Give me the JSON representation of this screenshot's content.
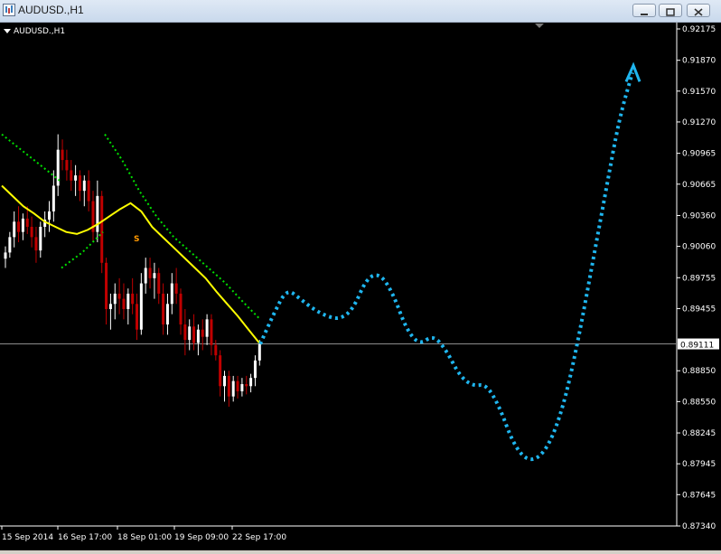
{
  "window": {
    "title": "AUDUSD.,H1"
  },
  "chart_label": "AUDUSD.,H1",
  "price_axis": [
    "0.92175",
    "0.91870",
    "0.91570",
    "0.91270",
    "0.90965",
    "0.90665",
    "0.90360",
    "0.90060",
    "0.89755",
    "0.89455",
    "0.89111",
    "0.88850",
    "0.88550",
    "0.88245",
    "0.87945",
    "0.87645",
    "0.87340"
  ],
  "current_price": "0.89111",
  "time_axis": [
    "15 Sep 2014",
    "16 Sep 17:00",
    "18 Sep 01:00",
    "19 Sep 09:00",
    "22 Sep 17:00"
  ],
  "annotation": "S",
  "colors": {
    "background": "#000000",
    "bull": "#ffffff",
    "bear": "#c00000",
    "ma": "#ffff00",
    "band": "#00e000",
    "forecast": "#1fb6ef",
    "axis": "#ffffff"
  },
  "chart_data": {
    "type": "candlestick",
    "ylim": [
      0.8734,
      0.92175
    ],
    "series": [
      {
        "name": "price_candles",
        "ohlc": [
          [
            0.8994,
            0.9006,
            0.8985,
            0.9
          ],
          [
            0.9,
            0.902,
            0.8995,
            0.9015
          ],
          [
            0.9015,
            0.904,
            0.9005,
            0.903
          ],
          [
            0.903,
            0.9045,
            0.901,
            0.902
          ],
          [
            0.902,
            0.9038,
            0.9012,
            0.9033
          ],
          [
            0.9033,
            0.9045,
            0.9018,
            0.9025
          ],
          [
            0.9025,
            0.9035,
            0.9005,
            0.9015
          ],
          [
            0.9015,
            0.9025,
            0.899,
            0.9002
          ],
          [
            0.9002,
            0.903,
            0.8995,
            0.9025
          ],
          [
            0.9025,
            0.904,
            0.9015,
            0.9032
          ],
          [
            0.9032,
            0.905,
            0.902,
            0.904
          ],
          [
            0.904,
            0.908,
            0.903,
            0.9065
          ],
          [
            0.9065,
            0.9115,
            0.9055,
            0.91
          ],
          [
            0.91,
            0.911,
            0.908,
            0.909
          ],
          [
            0.909,
            0.91,
            0.907,
            0.908
          ],
          [
            0.908,
            0.909,
            0.906,
            0.907
          ],
          [
            0.907,
            0.9085,
            0.9055,
            0.9075
          ],
          [
            0.9075,
            0.908,
            0.905,
            0.906
          ],
          [
            0.906,
            0.9075,
            0.9045,
            0.907
          ],
          [
            0.907,
            0.908,
            0.904,
            0.905
          ],
          [
            0.905,
            0.906,
            0.901,
            0.902
          ],
          [
            0.902,
            0.907,
            0.901,
            0.9055
          ],
          [
            0.9055,
            0.906,
            0.898,
            0.899
          ],
          [
            0.899,
            0.8995,
            0.893,
            0.8945
          ],
          [
            0.8945,
            0.896,
            0.8925,
            0.895
          ],
          [
            0.895,
            0.897,
            0.8935,
            0.896
          ],
          [
            0.896,
            0.8975,
            0.894,
            0.8955
          ],
          [
            0.8955,
            0.897,
            0.8935,
            0.8945
          ],
          [
            0.8945,
            0.8965,
            0.893,
            0.896
          ],
          [
            0.896,
            0.8975,
            0.894,
            0.895
          ],
          [
            0.895,
            0.896,
            0.8915,
            0.8925
          ],
          [
            0.8925,
            0.898,
            0.892,
            0.897
          ],
          [
            0.897,
            0.8995,
            0.896,
            0.8985
          ],
          [
            0.8985,
            0.8995,
            0.8965,
            0.8975
          ],
          [
            0.8975,
            0.899,
            0.8955,
            0.898
          ],
          [
            0.898,
            0.8985,
            0.895,
            0.896
          ],
          [
            0.896,
            0.897,
            0.892,
            0.893
          ],
          [
            0.893,
            0.896,
            0.892,
            0.895
          ],
          [
            0.895,
            0.898,
            0.894,
            0.897
          ],
          [
            0.897,
            0.8985,
            0.895,
            0.896
          ],
          [
            0.896,
            0.8965,
            0.892,
            0.893
          ],
          [
            0.893,
            0.8945,
            0.89,
            0.8915
          ],
          [
            0.8915,
            0.8935,
            0.8905,
            0.8928
          ],
          [
            0.8928,
            0.894,
            0.8905,
            0.8912
          ],
          [
            0.8912,
            0.893,
            0.89,
            0.8925
          ],
          [
            0.8925,
            0.8935,
            0.8905,
            0.8918
          ],
          [
            0.8918,
            0.894,
            0.891,
            0.8935
          ],
          [
            0.8935,
            0.894,
            0.89,
            0.891
          ],
          [
            0.891,
            0.8915,
            0.8895,
            0.89
          ],
          [
            0.89,
            0.8905,
            0.886,
            0.887
          ],
          [
            0.887,
            0.8885,
            0.8855,
            0.888
          ],
          [
            0.888,
            0.8885,
            0.885,
            0.886
          ],
          [
            0.886,
            0.888,
            0.8855,
            0.8875
          ],
          [
            0.8875,
            0.888,
            0.8858,
            0.8865
          ],
          [
            0.8865,
            0.8878,
            0.886,
            0.8872
          ],
          [
            0.8872,
            0.888,
            0.8862,
            0.887
          ],
          [
            0.887,
            0.8882,
            0.8864,
            0.8878
          ],
          [
            0.8878,
            0.89,
            0.887,
            0.8895
          ],
          [
            0.8895,
            0.8915,
            0.889,
            0.8911
          ]
        ]
      },
      {
        "name": "moving_average",
        "values": [
          0.9065,
          0.9055,
          0.9045,
          0.9038,
          0.903,
          0.9025,
          0.902,
          0.9018,
          0.9022,
          0.9028,
          0.9035,
          0.9042,
          0.9048,
          0.904,
          0.9025,
          0.9015,
          0.9005,
          0.8995,
          0.8985,
          0.8975,
          0.8962,
          0.895,
          0.8938,
          0.8925,
          0.8912
        ]
      },
      {
        "name": "band_upper",
        "values": [
          0.9115,
          0.91,
          0.9085,
          0.907
        ]
      },
      {
        "name": "band_lower",
        "values": [
          0.8985,
          0.9,
          0.902
        ]
      },
      {
        "name": "band_upper_2",
        "values": [
          0.9115,
          0.909,
          0.906,
          0.9035,
          0.9015,
          0.9,
          0.8985,
          0.897,
          0.8952,
          0.8935
        ]
      },
      {
        "name": "forecast",
        "values": [
          0.8911,
          0.894,
          0.8965,
          0.8955,
          0.8945,
          0.8938,
          0.8935,
          0.8945,
          0.8975,
          0.898,
          0.896,
          0.8925,
          0.891,
          0.892,
          0.8905,
          0.888,
          0.887,
          0.8872,
          0.885,
          0.8815,
          0.8798,
          0.88,
          0.882,
          0.886,
          0.892,
          0.899,
          0.906,
          0.913,
          0.9175
        ]
      }
    ]
  }
}
